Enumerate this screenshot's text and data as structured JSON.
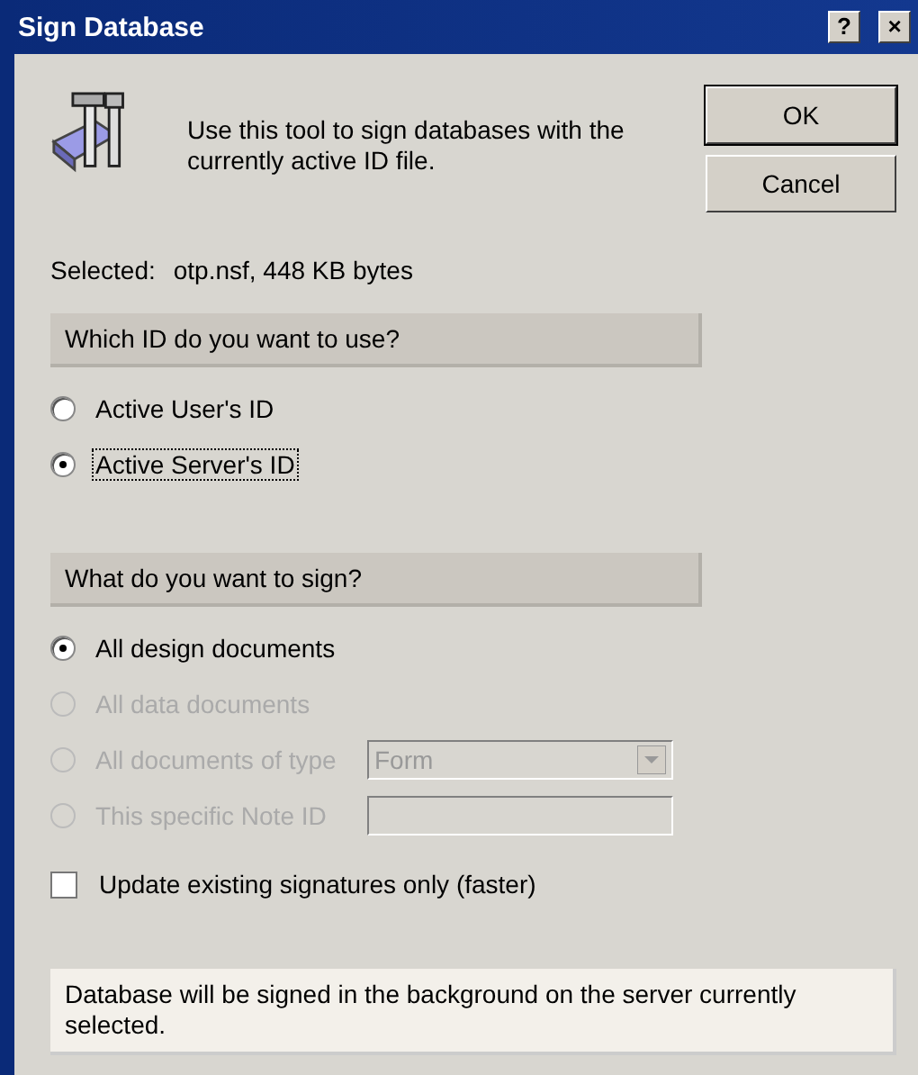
{
  "window": {
    "title": "Sign Database",
    "help_button": "?",
    "close_button": "×"
  },
  "intro": "Use this tool to sign databases with the currently active ID file.",
  "buttons": [
    {
      "label": "OK",
      "default": true
    },
    {
      "label": "Cancel",
      "default": false
    }
  ],
  "selected": {
    "label": "Selected:",
    "value": "otp.nsf, 448 KB bytes"
  },
  "id_group": {
    "heading": "Which ID do you want to use?",
    "options": [
      {
        "label": "Active User's ID",
        "selected": false,
        "focused": false
      },
      {
        "label": "Active Server's ID",
        "selected": true,
        "focused": true
      }
    ]
  },
  "sign_group": {
    "heading": "What do you want to sign?",
    "options": [
      {
        "label": "All design documents",
        "selected": true,
        "disabled": false
      },
      {
        "label": "All data documents",
        "selected": false,
        "disabled": true
      },
      {
        "label": "All documents of type",
        "selected": false,
        "disabled": true,
        "control": {
          "kind": "dropdown",
          "value": "Form"
        }
      },
      {
        "label": "This specific Note ID",
        "selected": false,
        "disabled": true,
        "control": {
          "kind": "text"
        }
      }
    ]
  },
  "update_only": {
    "label": "Update existing signatures only (faster)",
    "checked": false
  },
  "note": "Database will be signed in the background on the server currently selected."
}
